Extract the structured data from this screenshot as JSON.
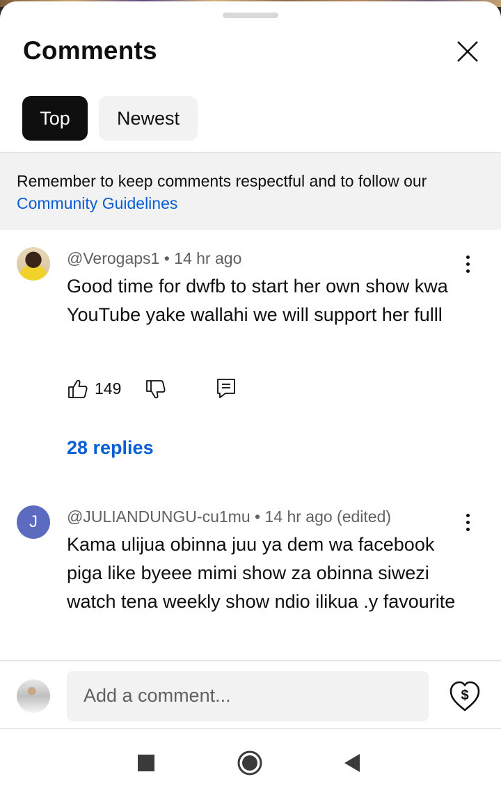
{
  "panel": {
    "title": "Comments",
    "close_icon": "close-icon"
  },
  "sort_chips": {
    "top": "Top",
    "newest": "Newest",
    "selected": "Top"
  },
  "notice": {
    "text": "Remember to keep comments respectful and to follow our",
    "link": "Community Guidelines"
  },
  "comments": [
    {
      "author": "@Verogaps1",
      "separator": "•",
      "time": "14 hr ago",
      "text": "Good time for  dwfb  to start her own show kwa YouTube yake  wallahi we will support her fulll",
      "likes": "149",
      "replies": "28 replies",
      "avatar_icon": "user-avatar-photo"
    },
    {
      "author": "@JULIANDUNGU-cu1mu",
      "separator": "•",
      "time": "14 hr ago (edited)",
      "text": "Kama ulijua obinna juu ya dem wa facebook piga like byeee mimi show za obinna siwezi watch tena weekly show ndio ilikua .y favourite",
      "avatar_letter": "J"
    }
  ],
  "composer": {
    "placeholder": "Add a comment...",
    "thanks_icon": "super-thanks-icon"
  },
  "system_nav": {
    "icons": [
      "recents-square-icon",
      "home-circle-icon",
      "back-triangle-icon"
    ]
  },
  "colors": {
    "link": "#065fd4",
    "chip_selected_bg": "#0f0f0f",
    "chip_bg": "#f2f2f2",
    "avatar_j": "#5c6bc0"
  }
}
